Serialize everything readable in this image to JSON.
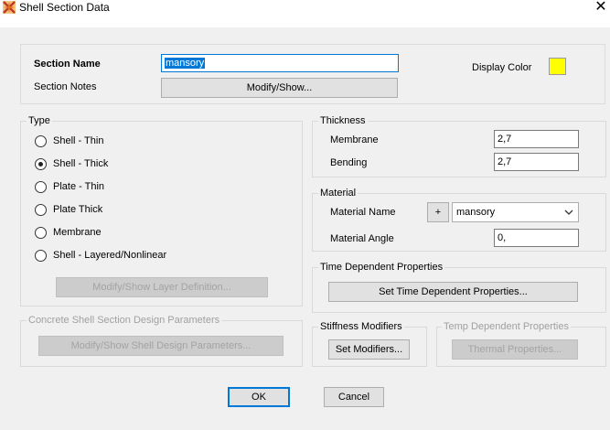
{
  "window": {
    "title": "Shell Section Data",
    "close_glyph": "✕"
  },
  "section": {
    "name_label": "Section Name",
    "name_value": "mansory",
    "notes_label": "Section Notes",
    "notes_button": "Modify/Show...",
    "display_color_label": "Display Color",
    "display_color": "#ffff00"
  },
  "type": {
    "title": "Type",
    "options": [
      {
        "label": "Shell - Thin",
        "selected": false
      },
      {
        "label": "Shell - Thick",
        "selected": true
      },
      {
        "label": "Plate - Thin",
        "selected": false
      },
      {
        "label": "Plate Thick",
        "selected": false
      },
      {
        "label": "Membrane",
        "selected": false
      },
      {
        "label": "Shell - Layered/Nonlinear",
        "selected": false
      }
    ],
    "layer_button": "Modify/Show Layer Definition..."
  },
  "thickness": {
    "title": "Thickness",
    "membrane_label": "Membrane",
    "membrane_value": "2,7",
    "bending_label": "Bending",
    "bending_value": "2,7"
  },
  "material": {
    "title": "Material",
    "name_label": "Material Name",
    "add_button": "+",
    "name_value": "mansory",
    "angle_label": "Material Angle",
    "angle_value": "0,"
  },
  "time_dependent": {
    "title": "Time Dependent Properties",
    "button": "Set Time Dependent Properties..."
  },
  "concrete": {
    "title": "Concrete Shell Section Design Parameters",
    "button": "Modify/Show Shell Design Parameters..."
  },
  "stiffness": {
    "title": "Stiffness Modifiers",
    "button": "Set Modifiers..."
  },
  "temp_dependent": {
    "title": "Temp Dependent Properties",
    "button": "Thermal Properties..."
  },
  "footer": {
    "ok": "OK",
    "cancel": "Cancel"
  }
}
